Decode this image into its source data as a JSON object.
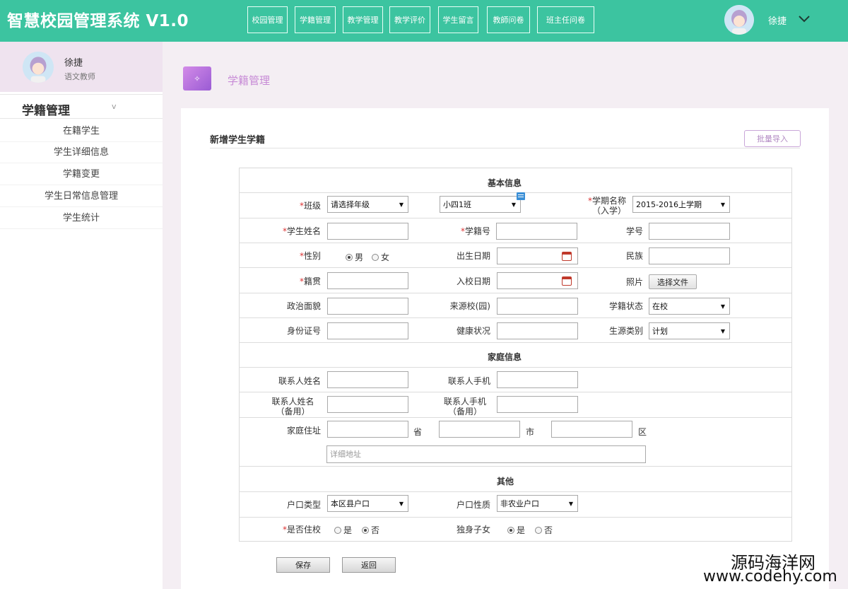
{
  "app": {
    "title": "智慧校园管理系统 V1.0"
  },
  "top_nav": [
    {
      "label": "校园管理"
    },
    {
      "label": "学籍管理"
    },
    {
      "label": "教学管理"
    },
    {
      "label": "教学评价"
    },
    {
      "label": "学生留言"
    },
    {
      "label": "教師问卷"
    },
    {
      "label": "班主任问卷"
    }
  ],
  "user": {
    "name": "徐捷",
    "role": "语文教师"
  },
  "sidebar": {
    "section_title": "学籍管理",
    "section_arrow": "v",
    "items": [
      {
        "label": "在籍学生"
      },
      {
        "label": "学生详细信息"
      },
      {
        "label": "学籍变更"
      },
      {
        "label": "学生日常信息管理"
      },
      {
        "label": "学生统计"
      }
    ]
  },
  "page": {
    "icon_glyph": "✧",
    "title": "学籍管理"
  },
  "panel": {
    "title": "新增学生学籍",
    "import_button": "批量导入"
  },
  "form": {
    "sections": {
      "basic": "基本信息",
      "family": "家庭信息",
      "other": "其他"
    },
    "required_mark": "*",
    "class": {
      "label": "班级",
      "grade_value": "请选择年级",
      "class_value": "小四1班"
    },
    "term": {
      "label": "学期名称",
      "label2": "（入学）",
      "value": "2015-2016上学期"
    },
    "student_name": {
      "label": "学生姓名",
      "value": ""
    },
    "student_reg_no": {
      "label": "学籍号",
      "value": ""
    },
    "student_no": {
      "label": "学号",
      "value": ""
    },
    "gender": {
      "label": "性别",
      "options": [
        "男",
        "女"
      ],
      "selected": "男"
    },
    "birth_date": {
      "label": "出生日期",
      "value": ""
    },
    "ethnicity": {
      "label": "民族",
      "value": ""
    },
    "native_place": {
      "label": "籍贯",
      "value": ""
    },
    "enroll_date": {
      "label": "入校日期",
      "value": ""
    },
    "photo": {
      "label": "照片",
      "button": "选择文件"
    },
    "political": {
      "label": "政治面貌",
      "value": ""
    },
    "source_school": {
      "label": "来源校(园)",
      "value": ""
    },
    "reg_status": {
      "label": "学籍状态",
      "value": "在校"
    },
    "id_number": {
      "label": "身份证号",
      "value": ""
    },
    "health": {
      "label": "健康状况",
      "value": ""
    },
    "source_type": {
      "label": "生源类别",
      "value": "计划"
    },
    "contact_name": {
      "label": "联系人姓名",
      "value": ""
    },
    "contact_phone": {
      "label": "联系人手机",
      "value": ""
    },
    "contact_name2": {
      "label": "联系人姓名",
      "label2": "（备用）",
      "value": ""
    },
    "contact_phone2": {
      "label": "联系人手机",
      "label2": "（备用）",
      "value": ""
    },
    "address": {
      "label": "家庭住址",
      "province_unit": "省",
      "city_unit": "市",
      "district_unit": "区",
      "detail_placeholder": "详细地址"
    },
    "hukou_type": {
      "label": "户口类型",
      "value": "本区县户口"
    },
    "hukou_nature": {
      "label": "户口性质",
      "value": "非农业户口"
    },
    "boarding": {
      "label": "是否住校",
      "options": [
        "是",
        "否"
      ],
      "selected": "否"
    },
    "only_child": {
      "label": "独身子女",
      "options": [
        "是",
        "否"
      ],
      "selected": "是"
    }
  },
  "actions": {
    "save": "保存",
    "back": "返回"
  },
  "watermark": {
    "line1": "源码海洋网",
    "line2": "www.codehy.com"
  },
  "colors": {
    "topbar": "#3cc4a0",
    "accent_purple": "#c78ad6",
    "required": "#dd3333"
  }
}
